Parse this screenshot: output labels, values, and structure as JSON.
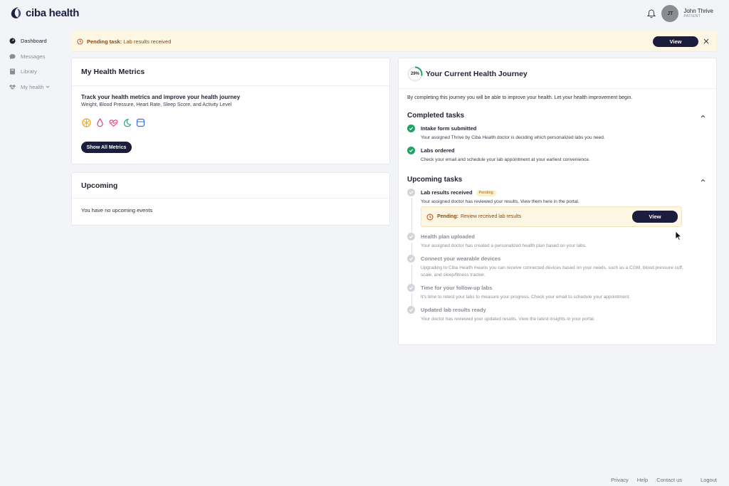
{
  "brand": {
    "name": "ciba health",
    "color": "#1d2040"
  },
  "header": {
    "user": {
      "initials": "JT",
      "name": "John Thrive",
      "role": "PATIENT"
    },
    "bell_icon": "bell-icon"
  },
  "sidebar": {
    "items": [
      {
        "label": "Dashboard",
        "icon": "dashboard-icon",
        "active": true
      },
      {
        "label": "Messages",
        "icon": "chat-bubble-icon",
        "active": false
      },
      {
        "label": "Library",
        "icon": "book-icon",
        "active": false
      },
      {
        "label": "My health",
        "icon": "heart-pulse-icon",
        "active": false,
        "has_dropdown": true
      }
    ]
  },
  "banner": {
    "label": "Pending task:",
    "text": "Lab results received",
    "view_label": "View",
    "close_icon": "close-icon"
  },
  "metrics_card": {
    "title": "My Health Metrics",
    "heading": "Track your health metrics and improve your health journey",
    "subheading": "Weight, Blood Pressure, Heart Rate, Sleep Score, and Activity Level",
    "icons": [
      "weight-icon",
      "blood-drop-icon",
      "heart-rate-icon",
      "sleep-moon-icon",
      "activity-icon"
    ],
    "button_label": "Show All Metrics"
  },
  "upcoming_card": {
    "title": "Upcoming",
    "empty_text": "You have no upcoming events"
  },
  "journey_card": {
    "progress_label": "29%",
    "progress_percent": 29,
    "title": "Your Current Health Journey",
    "intro": "By completing this journey you will be able to improve your health. Let your health improvement begin.",
    "completed": {
      "title": "Completed tasks",
      "tasks": [
        {
          "title": "Intake form submitted",
          "desc": "Your assigned Thrive by Ciba Health doctor is deciding which personalized labs you need."
        },
        {
          "title": "Labs ordered",
          "desc": "Check your email and schedule your lab appointment at your earliest convenience."
        }
      ]
    },
    "upcoming": {
      "title": "Upcoming tasks",
      "tasks": [
        {
          "title": "Lab results received",
          "badge": "Pending",
          "desc": "Your assigned doctor has reviewed your results. View them here in the portal."
        },
        {
          "title": "Health plan uploaded",
          "desc": "Your assigned doctor has created a personalized health plan based on your labs."
        },
        {
          "title": "Connect your wearable devices",
          "desc": "Upgrading to Ciba Health means you can receive connected devices based on your needs, such as a CGM, blood pressure cuff, scale, and sleep/fitness tracker."
        },
        {
          "title": "Time for your follow-up labs",
          "desc": "It's time to retest your labs to measure your progress. Check your email to schedule your appointment."
        },
        {
          "title": "Updated lab results ready",
          "desc": "Your doctor has reviewed your updated results. View the latest insights in your portal."
        }
      ],
      "pending_box": {
        "label": "Pending:",
        "text": "Review received lab results",
        "view_label": "View"
      }
    }
  },
  "footer": {
    "links": [
      "Privacy",
      "Help",
      "Contact us"
    ],
    "logout": "Logout"
  },
  "colors": {
    "accent_dark": "#1c1c3c",
    "success": "#21a366",
    "pending_bg": "#fdf6e3",
    "pending_text": "#8a4a12"
  }
}
